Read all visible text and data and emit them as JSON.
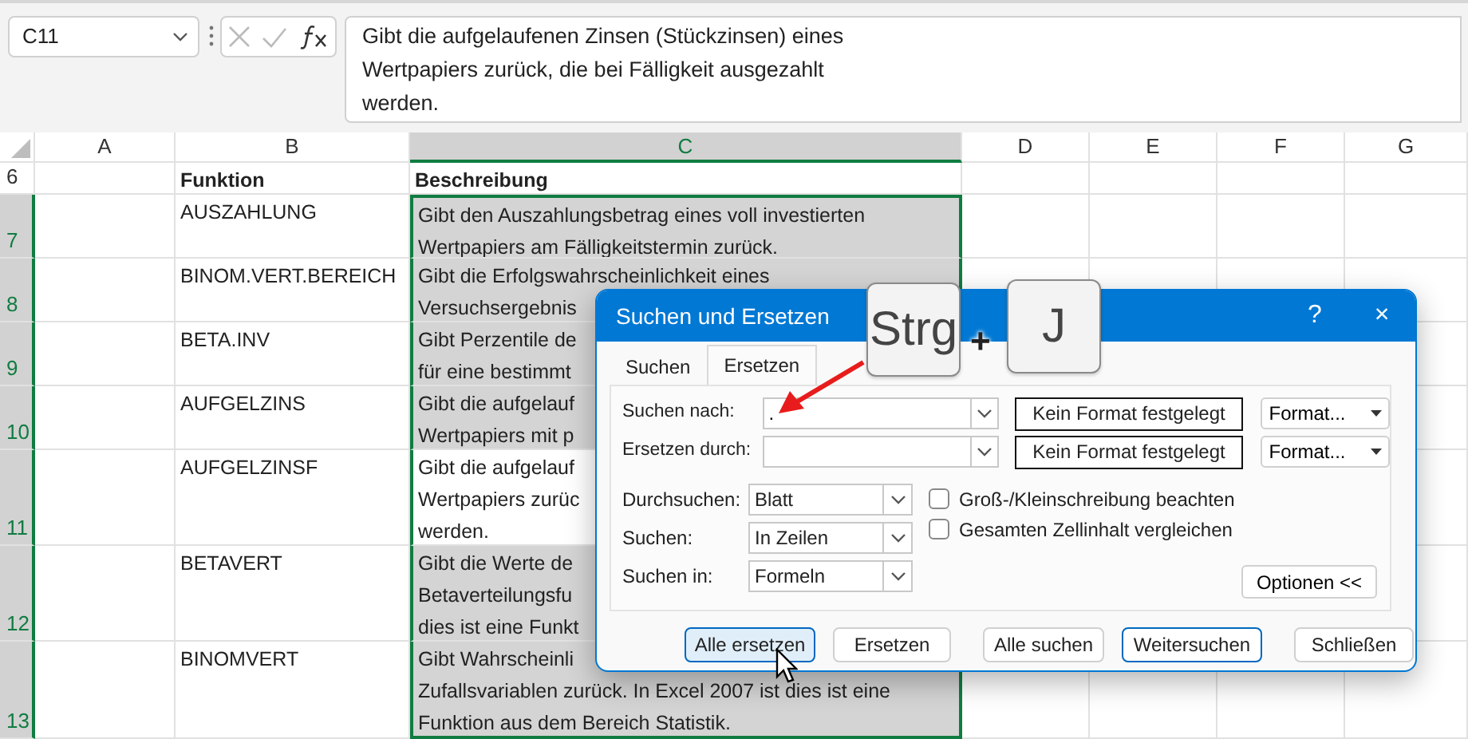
{
  "formula_bar": {
    "name_box": "C11",
    "formula": "Gibt die aufgelaufenen Zinsen (Stückzinsen) eines Wertpapiers zurück, die bei Fälligkeit ausgezahlt werden."
  },
  "columns": [
    {
      "label": "A",
      "selected": false
    },
    {
      "label": "B",
      "selected": false
    },
    {
      "label": "C",
      "selected": true
    },
    {
      "label": "D",
      "selected": false
    },
    {
      "label": "E",
      "selected": false
    },
    {
      "label": "F",
      "selected": false
    },
    {
      "label": "G",
      "selected": false
    }
  ],
  "rows": [
    {
      "number": "6",
      "kind": "header",
      "selected": false,
      "function": "Funktion",
      "description": [
        "Beschreibung"
      ]
    },
    {
      "number": "7",
      "kind": "data",
      "selected": true,
      "function": "AUSZAHLUNG",
      "description": [
        "Gibt den Auszahlungsbetrag eines voll investierten",
        "Wertpapiers am Fälligkeitstermin zurück."
      ],
      "active": false
    },
    {
      "number": "8",
      "kind": "data",
      "selected": true,
      "function": "BINOM.VERT.BEREICH",
      "description": [
        "Gibt die Erfolgswahrscheinlichkeit eines",
        "Versuchsergebnis"
      ],
      "active": false
    },
    {
      "number": "9",
      "kind": "data",
      "selected": true,
      "function": "BETA.INV",
      "description": [
        "Gibt Perzentile de",
        "für eine bestimmt"
      ],
      "active": false
    },
    {
      "number": "10",
      "kind": "data",
      "selected": true,
      "function": "AUFGELZINS",
      "description": [
        "Gibt die aufgelauf",
        "Wertpapiers mit p"
      ],
      "active": false
    },
    {
      "number": "11",
      "kind": "data",
      "selected": true,
      "function": "AUFGELZINSF",
      "description": [
        "Gibt die aufgelauf",
        "Wertpapiers zurüc",
        "werden."
      ],
      "active": true
    },
    {
      "number": "12",
      "kind": "data",
      "selected": true,
      "function": "BETAVERT",
      "description": [
        "Gibt die Werte de",
        "Betaverteilungsfu",
        "dies ist eine Funkt"
      ],
      "active": false
    },
    {
      "number": "13",
      "kind": "data",
      "selected": true,
      "function": "BINOMVERT",
      "description": [
        "Gibt Wahrscheinli",
        "Zufallsvariablen zurück. In Excel 2007 ist dies ist eine",
        "Funktion aus dem Bereich Statistik."
      ],
      "active": false
    }
  ],
  "dialog": {
    "title": "Suchen und Ersetzen",
    "help": "?",
    "close": "×",
    "tabs": [
      {
        "label": "Suchen",
        "selected": false
      },
      {
        "label": "Ersetzen",
        "selected": true
      }
    ],
    "fields": [
      {
        "label": "Suchen nach:",
        "value": ".",
        "format_status": "Kein Format festgelegt",
        "format_button": "Format..."
      },
      {
        "label": "Ersetzen durch:",
        "format_status": "Kein Format festgelegt",
        "format_button": "Format..."
      }
    ],
    "options": [
      {
        "label": "Durchsuchen:",
        "value": "Blatt"
      },
      {
        "label": "Suchen:",
        "value": "In Zeilen"
      },
      {
        "label": "Suchen in:",
        "value": "Formeln"
      }
    ],
    "checkboxes": [
      {
        "label": "Groß-/Kleinschreibung beachten",
        "checked": false
      },
      {
        "label": "Gesamten Zellinhalt vergleichen",
        "checked": false
      }
    ],
    "options_button": "Optionen <<",
    "buttons": [
      {
        "label": "Alle ersetzen",
        "hovered": true,
        "default": false
      },
      {
        "label": "Ersetzen",
        "hovered": false,
        "default": false
      },
      {
        "label": "Alle suchen",
        "hovered": false,
        "default": false
      },
      {
        "label": "Weitersuchen",
        "hovered": false,
        "default": true
      },
      {
        "label": "Schließen",
        "hovered": false,
        "default": false
      }
    ]
  },
  "shortcut": {
    "keys": [
      "Strg",
      "J"
    ],
    "joiner": "+"
  }
}
